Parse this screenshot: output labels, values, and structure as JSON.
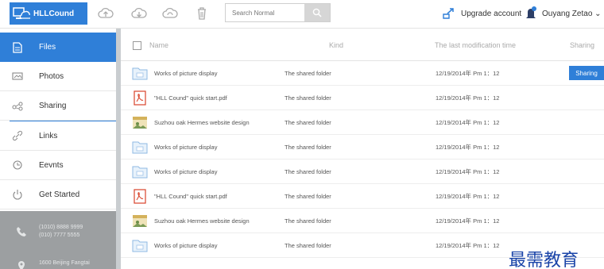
{
  "app": {
    "name": "HLLCound"
  },
  "search": {
    "placeholder": "Search Normal"
  },
  "header": {
    "upgrade_label": "Upgrade account",
    "user_name": "Ouyang Zetao ⌄"
  },
  "sidebar": {
    "items": [
      {
        "label": "Files",
        "icon": "file-icon"
      },
      {
        "label": "Photos",
        "icon": "photo-icon"
      },
      {
        "label": "Sharing",
        "icon": "share-icon"
      },
      {
        "label": "Links",
        "icon": "link-icon"
      },
      {
        "label": "Eevnts",
        "icon": "clock-icon"
      },
      {
        "label": "Get Started",
        "icon": "power-icon"
      }
    ],
    "contact": {
      "phone1": "(1010) 8888 9999",
      "phone2": "(010) 7777 5555",
      "address": "1600 Beijing Fangtai"
    }
  },
  "table": {
    "columns": {
      "name": "Name",
      "kind": "Kind",
      "time": "The last modification time",
      "sharing": "Sharing"
    },
    "share_button": "Sharing",
    "rows": [
      {
        "name": "Works of picture display",
        "kind": "The shared folder",
        "time": "12/19/2014年 Pm 1：12",
        "icon": "folder"
      },
      {
        "name": "\"HLL Cound\" quick start.pdf",
        "kind": "The shared folder",
        "time": "12/19/2014年 Pm 1：12",
        "icon": "pdf"
      },
      {
        "name": "Suzhou oak Hermes website design",
        "kind": "The shared folder",
        "time": "12/19/2014年 Pm 1：12",
        "icon": "image"
      },
      {
        "name": "Works of picture display",
        "kind": "The shared folder",
        "time": "12/19/2014年 Pm 1：12",
        "icon": "folder"
      },
      {
        "name": "Works of picture display",
        "kind": "The shared folder",
        "time": "12/19/2014年 Pm 1：12",
        "icon": "folder"
      },
      {
        "name": "\"HLL Cound\" quick start.pdf",
        "kind": "The shared folder",
        "time": "12/19/2014年 Pm 1：12",
        "icon": "pdf"
      },
      {
        "name": "Suzhou oak Hermes website design",
        "kind": "The shared folder",
        "time": "12/19/2014年 Pm 1：12",
        "icon": "image"
      },
      {
        "name": "Works of picture display",
        "kind": "The shared folder",
        "time": "12/19/2014年 Pm 1：12",
        "icon": "folder"
      }
    ]
  },
  "watermark": "最需教育",
  "colors": {
    "accent": "#2f7fd8",
    "sidebar_band": "#c9cdd0",
    "contact_bg": "#9c9fa1",
    "watermark": "#1a44a8"
  }
}
